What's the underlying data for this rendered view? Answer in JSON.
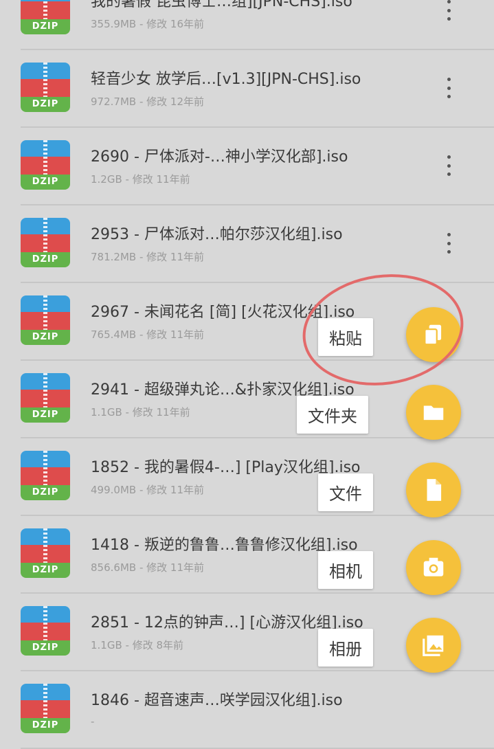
{
  "files": [
    {
      "name": "我的暑假 昆虫博士…组][JPN-CHS].iso",
      "size": "355.9MB",
      "modified": "修改 16年前"
    },
    {
      "name": "轻音少女 放学后…[v1.3][JPN-CHS].iso",
      "size": "972.7MB",
      "modified": "修改 12年前"
    },
    {
      "name": "2690 - 尸体派对-…神小学汉化部].iso",
      "size": "1.2GB",
      "modified": "修改 11年前"
    },
    {
      "name": "2953 - 尸体派对…帕尔莎汉化组].iso",
      "size": "781.2MB",
      "modified": "修改 11年前"
    },
    {
      "name": "2967 - 未闻花名 [简] [火花汉化组].iso",
      "size": "765.4MB",
      "modified": "修改 11年前"
    },
    {
      "name": "2941 - 超级弹丸论…&扑家汉化组].iso",
      "size": "1.1GB",
      "modified": "修改 11年前"
    },
    {
      "name": "1852 - 我的暑假4-…] [Play汉化组].iso",
      "size": "499.0MB",
      "modified": "修改 11年前"
    },
    {
      "name": "1418 - 叛逆的鲁鲁…鲁鲁修汉化组].iso",
      "size": "856.6MB",
      "modified": "修改 11年前"
    },
    {
      "name": "2851 - 12点的钟声…] [心游汉化组].iso",
      "size": "1.1GB",
      "modified": "修改 8年前"
    },
    {
      "name": "1846 - 超音速声…咲学园汉化组].iso",
      "size": "",
      "modified": ""
    }
  ],
  "icon_label": "DZIP",
  "separator": " - ",
  "fab_menu": [
    {
      "label": "粘贴",
      "icon": "paste-icon"
    },
    {
      "label": "文件夹",
      "icon": "folder-icon"
    },
    {
      "label": "文件",
      "icon": "file-icon"
    },
    {
      "label": "相机",
      "icon": "camera-icon"
    },
    {
      "label": "相册",
      "icon": "gallery-icon"
    }
  ],
  "colors": {
    "fab": "#f5c13b",
    "annotation": "#e36a6a",
    "zip_blue": "#3b9fdc",
    "zip_red": "#de4c4c",
    "zip_green": "#63b34a"
  }
}
